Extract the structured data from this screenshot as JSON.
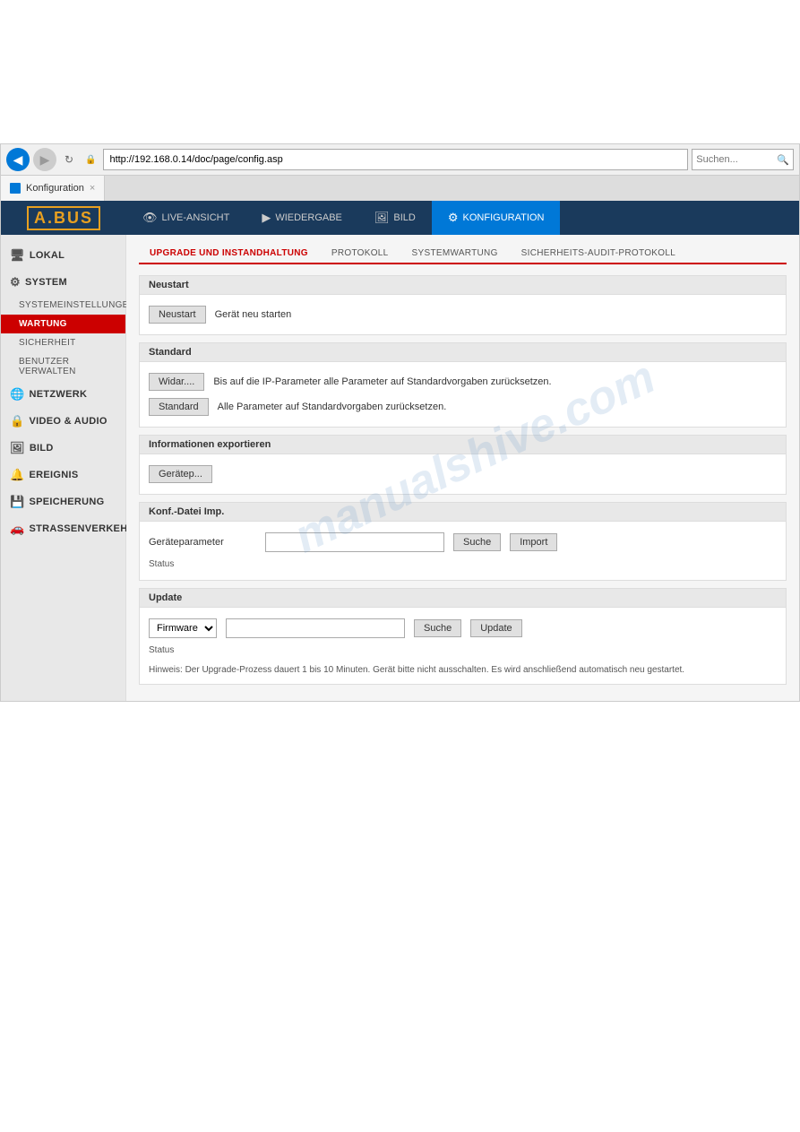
{
  "browser": {
    "url": "http://192.168.0.14/doc/page/config.asp",
    "tab_title": "Konfiguration",
    "search_placeholder": "Suchen...",
    "back_icon": "◀",
    "forward_icon": "▶",
    "refresh_icon": "↻",
    "close_icon": "×"
  },
  "top_nav": {
    "logo": "A.BUS",
    "items": [
      {
        "id": "live",
        "label": "LIVE-ANSICHT",
        "icon": "👁"
      },
      {
        "id": "playback",
        "label": "WIEDERGABE",
        "icon": "▶"
      },
      {
        "id": "image",
        "label": "BILD",
        "icon": "🖼"
      },
      {
        "id": "config",
        "label": "KONFIGURATION",
        "icon": "⚙",
        "active": true
      }
    ]
  },
  "sidebar": {
    "items": [
      {
        "id": "lokal",
        "label": "LOKAL",
        "icon": "🖥"
      },
      {
        "id": "system",
        "label": "SYSTEM",
        "icon": "⚙"
      },
      {
        "id": "systemeinstellungen",
        "label": "SYSTEMEINSTELLUNGEN",
        "sub": true
      },
      {
        "id": "wartung",
        "label": "WARTUNG",
        "sub": true,
        "active": true
      },
      {
        "id": "sicherheit",
        "label": "SICHERHEIT",
        "sub": true
      },
      {
        "id": "benutzer",
        "label": "BENUTZER VERWALTEN",
        "sub": true
      },
      {
        "id": "netzwerk",
        "label": "NETZWERK",
        "icon": "🌐"
      },
      {
        "id": "video",
        "label": "VIDEO & AUDIO",
        "icon": "🔒"
      },
      {
        "id": "bild",
        "label": "BILD",
        "icon": "🖼"
      },
      {
        "id": "ereignis",
        "label": "EREIGNIS",
        "icon": "🔔"
      },
      {
        "id": "speicherung",
        "label": "SPEICHERUNG",
        "icon": "💾"
      },
      {
        "id": "strassenverkehr",
        "label": "STRASSENVERKEHR",
        "icon": "🚗"
      }
    ]
  },
  "main": {
    "tabs": [
      {
        "id": "upgrade",
        "label": "UPGRADE UND INSTANDHALTUNG",
        "active": true
      },
      {
        "id": "protokoll",
        "label": "PROTOKOLL"
      },
      {
        "id": "systemwartung",
        "label": "SYSTEMWARTUNG"
      },
      {
        "id": "sicherheitsaudit",
        "label": "SICHERHEITS-AUDIT-PROTOKOLL"
      }
    ],
    "sections": {
      "neustart": {
        "title": "Neustart",
        "button_label": "Neustart",
        "description": "Gerät neu starten"
      },
      "standard": {
        "title": "Standard",
        "buttons": [
          {
            "label": "Widar....",
            "description": "Bis auf die IP-Parameter alle Parameter auf Standardvorgaben zurücksetzen."
          },
          {
            "label": "Standard",
            "description": "Alle Parameter auf Standardvorgaben zurücksetzen."
          }
        ]
      },
      "info_export": {
        "title": "Informationen exportieren",
        "button_label": "Gerätep..."
      },
      "konf_datei": {
        "title": "Konf.-Datei Imp.",
        "field_label": "Geräteparameter",
        "status_label": "Status",
        "button_suche": "Suche",
        "button_import": "Import"
      },
      "update": {
        "title": "Update",
        "dropdown_value": "Firmware",
        "dropdown_options": [
          "Firmware"
        ],
        "status_label": "Status",
        "button_suche": "Suche",
        "button_update": "Update",
        "hint": "Hinweis: Der Upgrade-Prozess dauert 1 bis 10 Minuten. Gerät bitte nicht ausschalten. Es wird anschließend automatisch neu gestartet."
      }
    }
  },
  "watermark": "manualshive.com"
}
